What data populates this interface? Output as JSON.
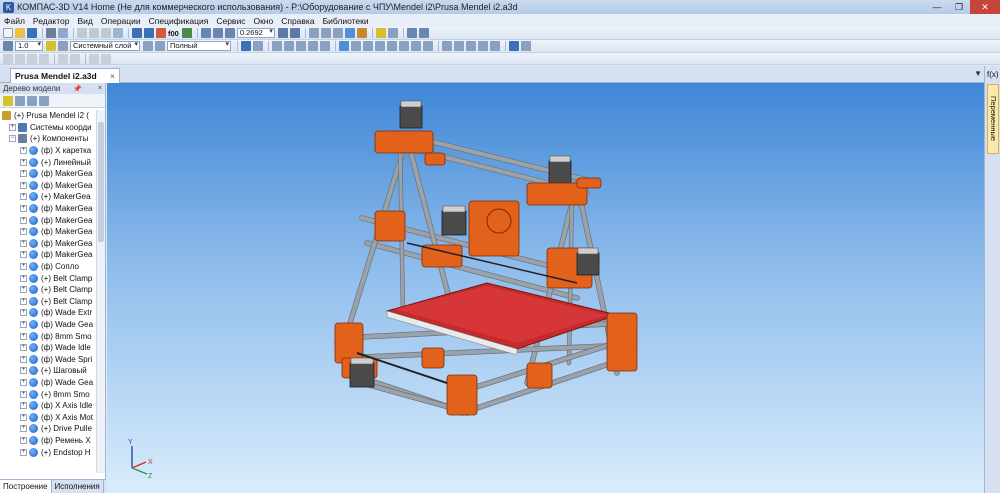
{
  "window": {
    "title": "КОМПАС-3D V14 Home (Не для коммерческого использования) - P:\\Оборудование с ЧПУ\\Mendel i2\\Prusa Mendel i2.a3d"
  },
  "menu": [
    "Файл",
    "Редактор",
    "Вид",
    "Операции",
    "Спецификация",
    "Сервис",
    "Окно",
    "Справка",
    "Библиотеки"
  ],
  "toolbar": {
    "zoom_value": "0.2692",
    "scale_value": "1.0",
    "layer_value": "Системный слой",
    "mode_value": "Полный",
    "f00": "f00"
  },
  "document_tab": "Prusa Mendel i2.a3d",
  "model_tree": {
    "title": "Дерево модели",
    "items": [
      {
        "exp": "",
        "icon": "root",
        "label": "(+) Prusa Mendel i2 ("
      },
      {
        "exp": "+",
        "icon": "sys",
        "label": "Системы коорди"
      },
      {
        "exp": "−",
        "icon": "comp",
        "label": "(+) Компоненты"
      },
      {
        "exp": "+",
        "icon": "part",
        "label": "(ф) X каретка"
      },
      {
        "exp": "+",
        "icon": "part",
        "label": "(+) Линейный"
      },
      {
        "exp": "+",
        "icon": "part",
        "label": "(ф) MakerGea"
      },
      {
        "exp": "+",
        "icon": "part",
        "label": "(ф) MakerGea"
      },
      {
        "exp": "+",
        "icon": "part",
        "label": "(+) MakerGea"
      },
      {
        "exp": "+",
        "icon": "part",
        "label": "(ф) MakerGea"
      },
      {
        "exp": "+",
        "icon": "part",
        "label": "(ф) MakerGea"
      },
      {
        "exp": "+",
        "icon": "part",
        "label": "(ф) MakerGea"
      },
      {
        "exp": "+",
        "icon": "part",
        "label": "(ф) MakerGea"
      },
      {
        "exp": "+",
        "icon": "part",
        "label": "(ф) MakerGea"
      },
      {
        "exp": "+",
        "icon": "part",
        "label": "(ф) Сопло"
      },
      {
        "exp": "+",
        "icon": "part",
        "label": "(+) Belt Clamp"
      },
      {
        "exp": "+",
        "icon": "part",
        "label": "(+) Belt Clamp"
      },
      {
        "exp": "+",
        "icon": "part",
        "label": "(+) Belt Clamp"
      },
      {
        "exp": "+",
        "icon": "part",
        "label": "(ф) Wade Extr"
      },
      {
        "exp": "+",
        "icon": "part",
        "label": "(ф) Wade Gea"
      },
      {
        "exp": "+",
        "icon": "part",
        "label": "(ф) 8mm Smo"
      },
      {
        "exp": "+",
        "icon": "part",
        "label": "(ф) Wade Idle"
      },
      {
        "exp": "+",
        "icon": "part",
        "label": "(ф) Wade Spri"
      },
      {
        "exp": "+",
        "icon": "part",
        "label": "(+) Шаговый"
      },
      {
        "exp": "+",
        "icon": "part",
        "label": "(ф) Wade Gea"
      },
      {
        "exp": "+",
        "icon": "part",
        "label": "(+) 8mm Smo"
      },
      {
        "exp": "+",
        "icon": "part",
        "label": "(ф) X Axis Idle"
      },
      {
        "exp": "+",
        "icon": "part",
        "label": "(ф) X Axis Mot"
      },
      {
        "exp": "+",
        "icon": "part",
        "label": "(+) Drive Pulle"
      },
      {
        "exp": "+",
        "icon": "part",
        "label": "(ф) Ремень X"
      },
      {
        "exp": "+",
        "icon": "part",
        "label": "(+) Endstop H"
      }
    ]
  },
  "bottom_tabs": [
    "Построение",
    "Исполнения"
  ],
  "right_panel": {
    "fx_label": "f(x)",
    "tab_label": "Переменные"
  },
  "axis_labels": {
    "x": "X",
    "y": "Y",
    "z": "Z"
  },
  "colors": {
    "frame": "#e2621c",
    "rod": "#9aa3ab",
    "bed": "#d8383a",
    "motor": "#4a4a4a"
  }
}
